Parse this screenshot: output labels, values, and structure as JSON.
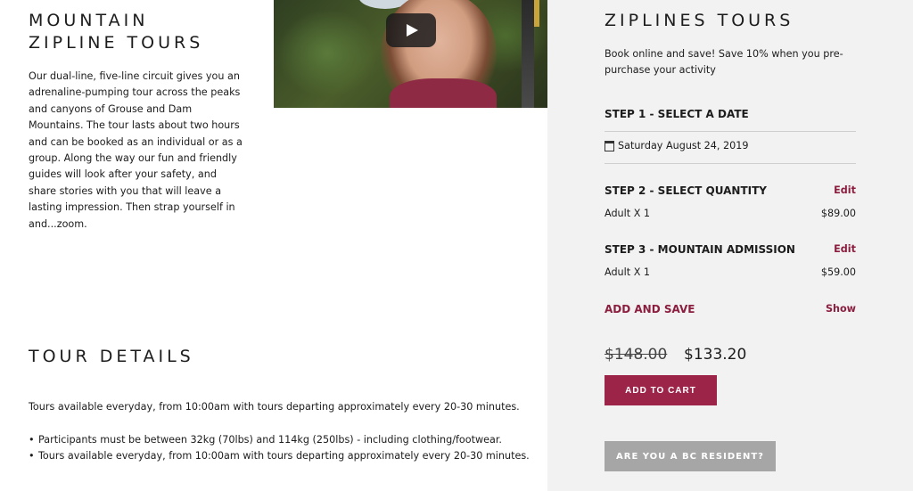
{
  "left": {
    "title_line1": "MOUNTAIN",
    "title_line2": "ZIPLINE TOURS",
    "intro": "Our dual-line, five-line circuit gives you an adrenaline-pumping tour across the peaks and canyons of Grouse and Dam Mountains. The tour lasts about two hours and can be booked as an individual or as a group. Along the way our fun and friendly guides will look after your safety, and share stories with you that will leave a lasting impression. Then strap yourself in and...zoom.",
    "video_play_icon": "play-icon"
  },
  "tour_details": {
    "title": "TOUR DETAILS",
    "text": "Tours available everyday, from 10:00am with tours departing approximately every 20-30 minutes.",
    "bullets": [
      "Participants must be between 32kg (70lbs) and 114kg (250lbs) - including clothing/footwear.",
      "Tours available everyday, from 10:00am with tours departing approximately every 20-30 minutes."
    ]
  },
  "booking": {
    "title": "ZIPLINES TOURS",
    "subtitle": "Book online and save! Save 10% when you pre-purchase your activity",
    "step1": "STEP 1 - SELECT A DATE",
    "date": "Saturday August 24, 2019",
    "calendar_icon": "calendar-icon",
    "step2": "STEP 2 - SELECT QUANTITY",
    "step2_edit": "Edit",
    "step2_item": "Adult X 1",
    "step2_price": "$89.00",
    "step3": "STEP 3 - MOUNTAIN ADMISSION",
    "step3_edit": "Edit",
    "step3_item": "Adult X 1",
    "step3_price": "$59.00",
    "add_and_save": "ADD AND SAVE",
    "show": "Show",
    "old_price": "$148.00",
    "new_price": "$133.20",
    "add_to_cart": "ADD TO CART",
    "bc_resident": "ARE YOU A BC RESIDENT?"
  },
  "colors": {
    "accent": "#8b1e3f",
    "cart_button": "#9c2449",
    "panel_bg": "#f2f2f2",
    "secondary_button": "#a6a6a6"
  }
}
